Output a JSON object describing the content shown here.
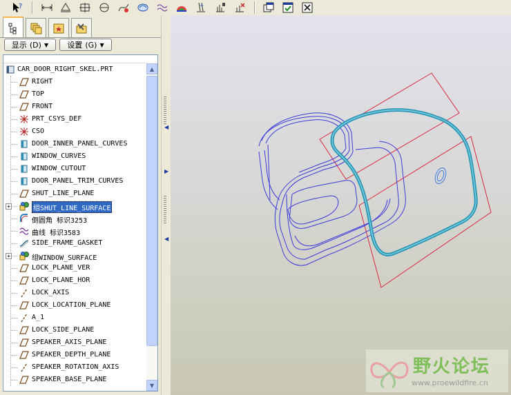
{
  "toolbar": {
    "icons": [
      "whats-this-icon",
      "dimension-icon",
      "sketch-tri-icon",
      "coord-grid-icon",
      "sheet-icon",
      "curve-tool-icon",
      "datum-display-icon",
      "spline-icon",
      "render-icon",
      "datum-plane-tool-icon",
      "axis-tool-icon",
      "points-tool-icon",
      "window-restore-icon",
      "window-activate-icon",
      "window-close-icon"
    ]
  },
  "panel": {
    "tabs": [
      "model-tree-tab",
      "layers-tab",
      "favorites-tab",
      "tools-tab"
    ],
    "display_label": "显示",
    "display_key": "(D)",
    "settings_label": "设置",
    "settings_key": "(G)"
  },
  "tree": {
    "root": "CAR_DOOR_RIGHT_SKEL.PRT",
    "items": [
      {
        "label": "RIGHT",
        "icon": "datum-plane-icon"
      },
      {
        "label": "TOP",
        "icon": "datum-plane-icon"
      },
      {
        "label": "FRONT",
        "icon": "datum-plane-icon"
      },
      {
        "label": "PRT_CSYS_DEF",
        "icon": "csys-icon"
      },
      {
        "label": "CSO",
        "icon": "csys-icon"
      },
      {
        "label": "DOOR_INNER_PANEL_CURVES",
        "icon": "copy-geom-icon"
      },
      {
        "label": "WINDOW_CURVES",
        "icon": "copy-geom-icon"
      },
      {
        "label": "WINDOW_CUTOUT",
        "icon": "copy-geom-icon"
      },
      {
        "label": "DOOR_PANEL_TRIM_CURVES",
        "icon": "copy-geom-icon"
      },
      {
        "label": "SHUT_LINE_PLANE",
        "icon": "datum-plane-icon"
      },
      {
        "label": "组SHUT_LINE_SURFACE",
        "icon": "group-icon"
      },
      {
        "label": "倒圆角 标识3253",
        "icon": "round-icon"
      },
      {
        "label": "曲线 标识3583",
        "icon": "curve-icon"
      },
      {
        "label": "SIDE_FRAME_GASKET",
        "icon": "sweep-icon"
      },
      {
        "label": "组WINDOW_SURFACE",
        "icon": "group-icon"
      },
      {
        "label": "LOCK_PLANE_VER",
        "icon": "datum-plane-icon"
      },
      {
        "label": "LOCK_PLANE_HOR",
        "icon": "datum-plane-icon"
      },
      {
        "label": "LOCK_AXIS",
        "icon": "axis-icon"
      },
      {
        "label": "LOCK_LOCATION_PLANE",
        "icon": "datum-plane-icon"
      },
      {
        "label": "A_1",
        "icon": "axis-icon"
      },
      {
        "label": "LOCK_SIDE_PLANE",
        "icon": "datum-plane-icon"
      },
      {
        "label": "SPEAKER_AXIS_PLANE",
        "icon": "datum-plane-icon"
      },
      {
        "label": "SPEAKER_DEPTH_PLANE",
        "icon": "datum-plane-icon"
      },
      {
        "label": "SPEAKER_ROTATION_AXIS",
        "icon": "axis-icon"
      },
      {
        "label": "SPEAKER_BASE_PLANE",
        "icon": "datum-plane-icon"
      }
    ],
    "selected_index": 10
  },
  "watermark": {
    "title": "野火论坛",
    "url": "www.proewildfire.cn"
  },
  "colors": {
    "selection": "#316ac5",
    "curve_blue": "#3a3ad8",
    "plane_red": "#d8283c",
    "gasket_teal": "#2a97b5"
  }
}
